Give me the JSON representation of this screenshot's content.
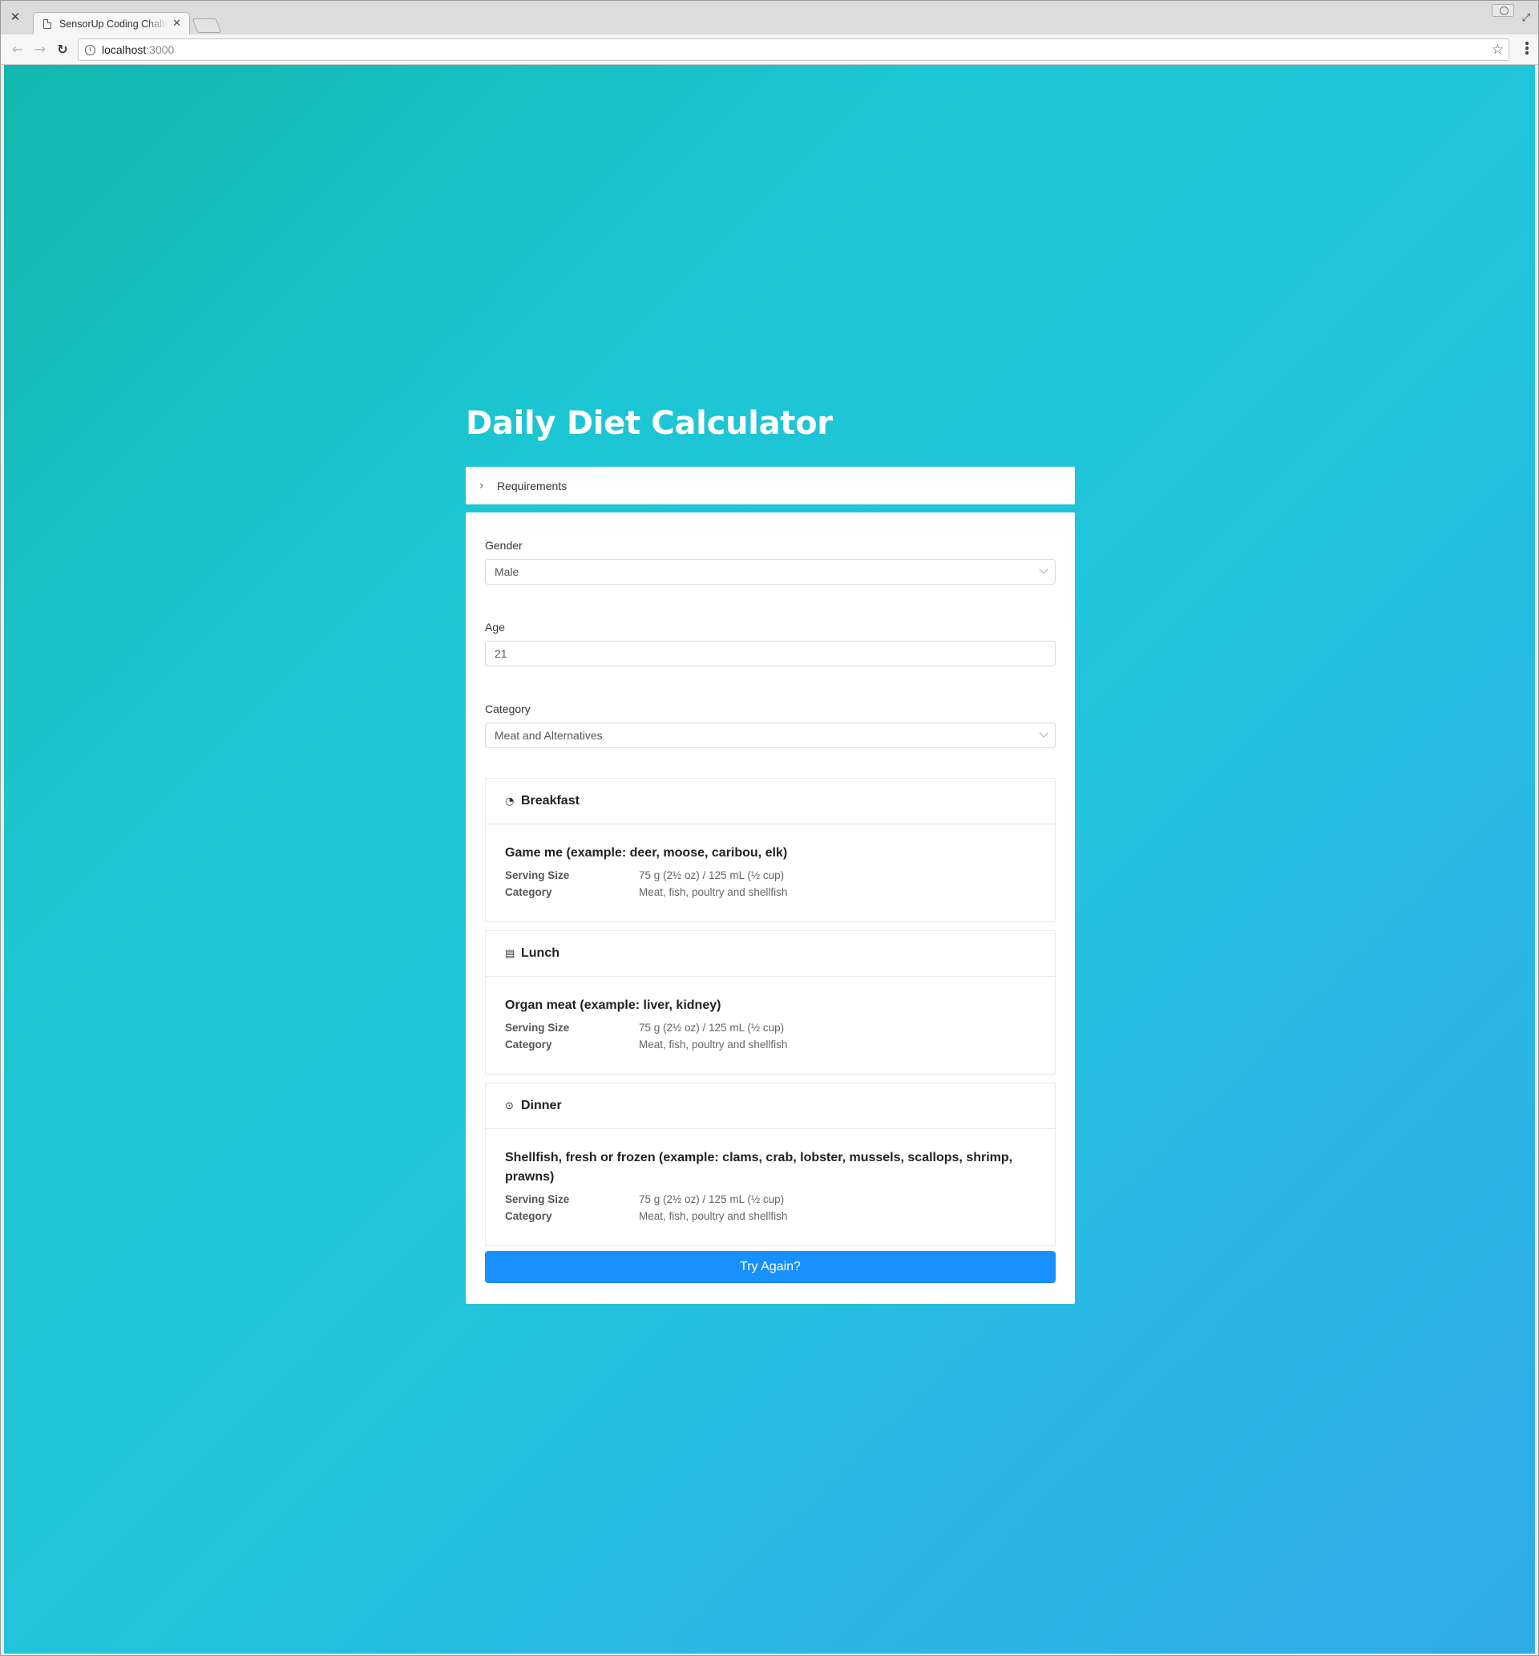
{
  "browser": {
    "tab_title": "SensorUp Coding Challenge",
    "url_host": "localhost",
    "url_port": ":3000"
  },
  "page": {
    "title": "Daily Diet Calculator",
    "requirements_label": "Requirements",
    "form": {
      "gender_label": "Gender",
      "gender_value": "Male",
      "age_label": "Age",
      "age_value": "21",
      "category_label": "Category",
      "category_value": "Meat and Alternatives"
    },
    "meals": [
      {
        "name": "Breakfast",
        "icon": "egg-icon",
        "food": "Game me (example: deer, moose, caribou, elk)",
        "serving_size_label": "Serving Size",
        "serving_size": "75 g (2½ oz) / 125 mL (½ cup)",
        "category_label": "Category",
        "category": "Meat, fish, poultry and shellfish"
      },
      {
        "name": "Lunch",
        "icon": "bento-icon",
        "food": "Organ meat (example: liver, kidney)",
        "serving_size_label": "Serving Size",
        "serving_size": "75 g (2½ oz) / 125 mL (½ cup)",
        "category_label": "Category",
        "category": "Meat, fish, poultry and shellfish"
      },
      {
        "name": "Dinner",
        "icon": "plate-cutlery-icon",
        "food": "Shellfish, fresh or frozen (example: clams, crab, lobster, mussels, scallops, shrimp, prawns)",
        "serving_size_label": "Serving Size",
        "serving_size": "75 g (2½ oz) / 125 mL (½ cup)",
        "category_label": "Category",
        "category": "Meat, fish, poultry and shellfish"
      }
    ],
    "try_again_label": "Try Again?"
  },
  "colors": {
    "gradient_start": "#12b7ae",
    "gradient_end": "#2fabe8",
    "primary_button": "#1890ff"
  }
}
